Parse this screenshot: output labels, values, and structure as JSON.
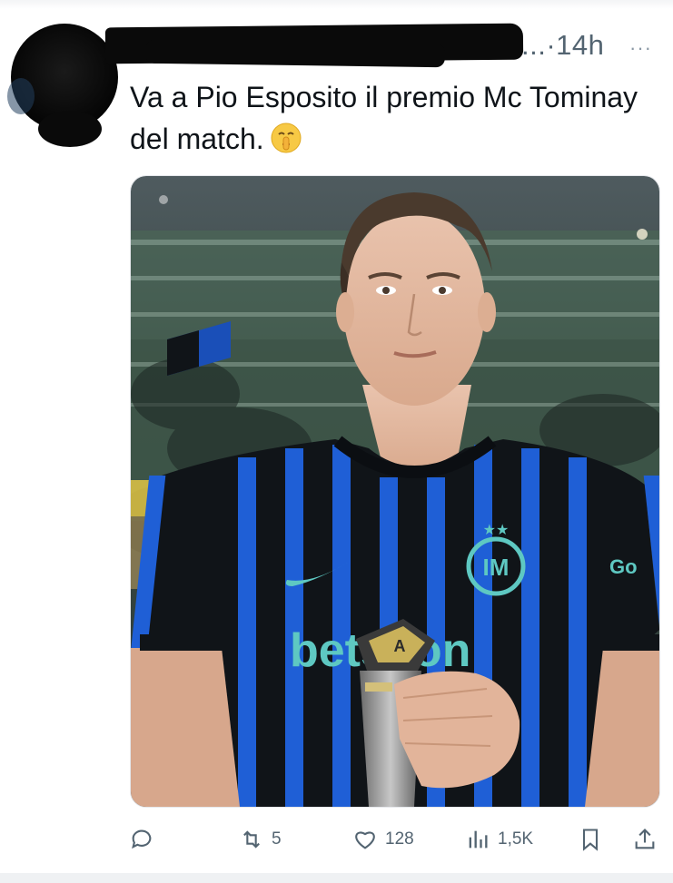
{
  "post": {
    "author_redacted": true,
    "meta": "...·14h",
    "more": "···",
    "text": "Va a Pio Esposito il premio Mc Tominay del match.",
    "emoji": "shushing-face-emoji"
  },
  "media": {
    "sponsor_text": "betsson",
    "sleeve_text": "Go",
    "scene": "stadium"
  },
  "actions": {
    "reply": {
      "icon": "reply-icon",
      "count": ""
    },
    "repost": {
      "icon": "repost-icon",
      "count": "5"
    },
    "like": {
      "icon": "heart-icon",
      "count": "128"
    },
    "views": {
      "icon": "views-icon",
      "count": "1,5K"
    },
    "bookmark": {
      "icon": "bookmark-icon"
    },
    "share": {
      "icon": "share-icon"
    }
  },
  "colors": {
    "text": "#0f1419",
    "muted": "#536471",
    "jersey_blue": "#1f5fd6",
    "teal": "#5ec8c2"
  }
}
